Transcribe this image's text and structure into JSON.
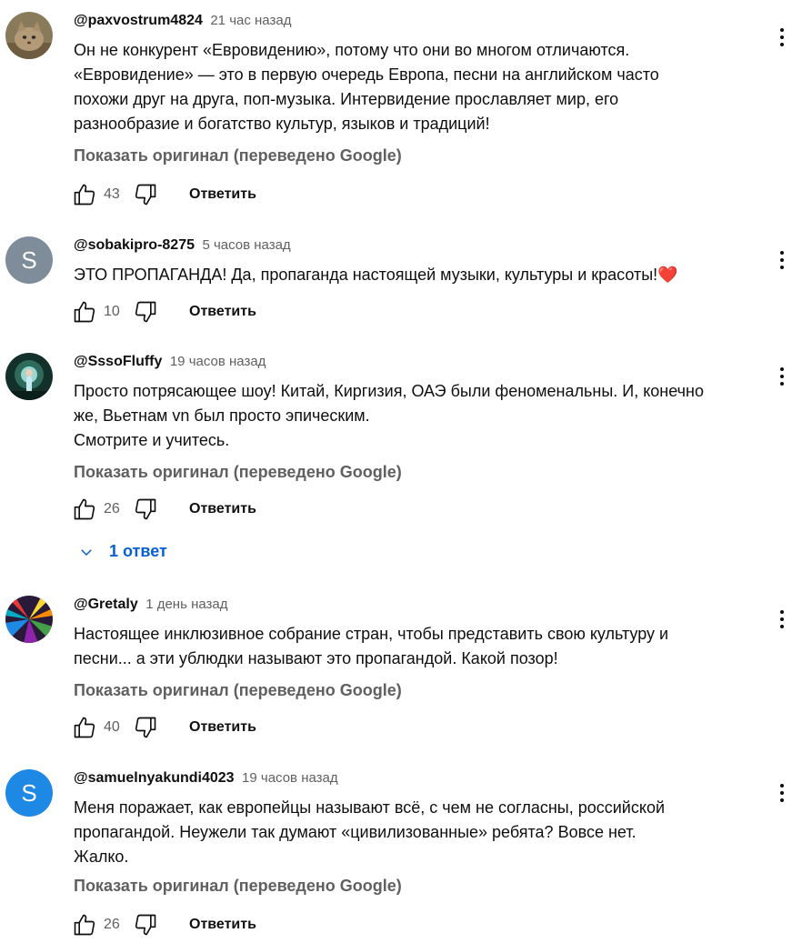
{
  "comments": [
    {
      "author": "@paxvostrum4824",
      "time": "21 час назад",
      "lines": [
        "Он не конкурент «Евровидению», потому что они во многом отличаются.",
        "«Евровидение» — это в первую очередь Европа, песни на английском часто",
        "похожи друг на друга, поп-музыка. Интервидение прославляет мир, его",
        "разнообразие и богатство культур, языков и традиций!"
      ],
      "translate": "Показать оригинал (переведено Google)",
      "likes": "43",
      "reply": "Ответить",
      "avatar": "cat-photo"
    },
    {
      "author": "@sobakipro-8275",
      "time": "5 часов назад",
      "lines": [
        "ЭТО ПРОПАГАНДА! Да, пропаганда настоящей музыки, культуры и красоты!❤️"
      ],
      "likes": "10",
      "reply": "Ответить",
      "avatar_letter": "S",
      "avatar_color": "#7e8d99"
    },
    {
      "author": "@SssoFluffy",
      "time": "19 часов назад",
      "lines": [
        "Просто потрясающее шоу! Китай, Киргизия, ОАЭ были феноменальны. И, конечно",
        "же, Вьетнам vn был просто эпическим.",
        "Смотрите и учитесь."
      ],
      "translate": "Показать оригинал (переведено Google)",
      "likes": "26",
      "reply": "Ответить",
      "replies": "1 ответ",
      "avatar": "fairy-photo"
    },
    {
      "author": "@Gretaly",
      "time": "1 день назад",
      "lines": [
        "Настоящее инклюзивное собрание стран, чтобы представить свою культуру и",
        "песни... а эти ублюдки называют это пропагандой. Какой позор!"
      ],
      "translate": "Показать оригинал (переведено Google)",
      "likes": "40",
      "reply": "Ответить",
      "avatar": "abstract-art"
    },
    {
      "author": "@samuelnyakundi4023",
      "time": "19 часов назад",
      "lines": [
        "Меня поражает, как европейцы называют всё, с чем не согласны, российской",
        "пропагандой. Неужели так думают «цивилизованные» ребята? Вовсе нет.",
        "Жалко."
      ],
      "translate": "Показать оригинал (переведено Google)",
      "likes": "26",
      "reply": "Ответить",
      "avatar_letter": "S",
      "avatar_color": "#1e88e5"
    }
  ],
  "colors": {
    "text": "#0f0f0f",
    "secondary": "#606060",
    "link_blue": "#065fd4"
  },
  "icons": [
    "like-icon",
    "dislike-icon",
    "more-vert-icon",
    "chevron-down-icon",
    "heart-emoji"
  ]
}
